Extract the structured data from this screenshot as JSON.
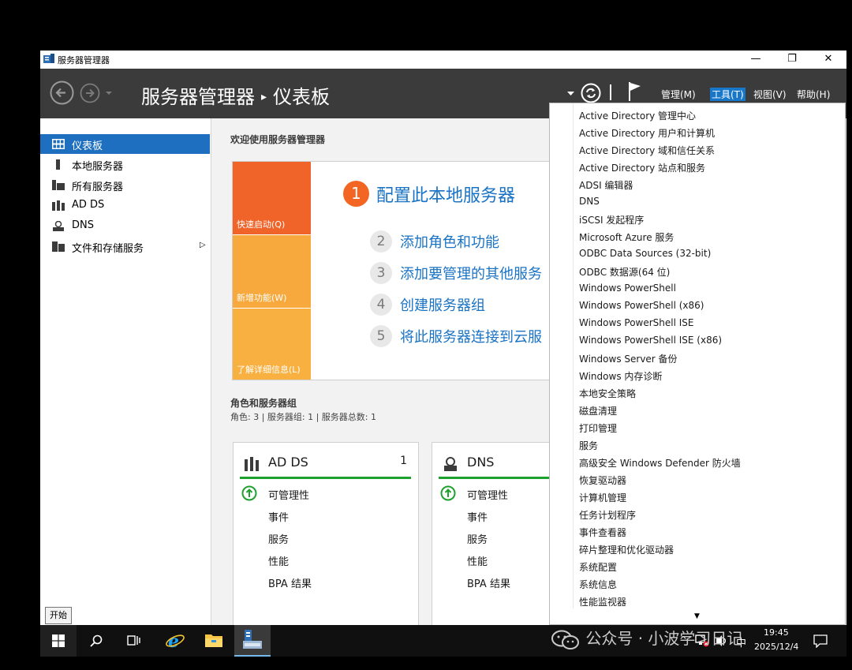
{
  "window": {
    "title": "服务器管理器",
    "buttons": {
      "minimize": "—",
      "maximize": "❐",
      "close": "✕"
    }
  },
  "header": {
    "app_name": "服务器管理器",
    "separator": "▸",
    "page": "仪表板",
    "menus": [
      {
        "label": "管理(M)",
        "active": false
      },
      {
        "label": "工具(T)",
        "active": true
      },
      {
        "label": "视图(V)",
        "active": false
      },
      {
        "label": "帮助(H)",
        "active": false
      }
    ]
  },
  "sidebar": {
    "items": [
      {
        "label": "仪表板",
        "icon": "dashboard-icon",
        "active": true
      },
      {
        "label": "本地服务器",
        "icon": "local-server-icon",
        "active": false
      },
      {
        "label": "所有服务器",
        "icon": "all-servers-icon",
        "active": false
      },
      {
        "label": "AD DS",
        "icon": "ad-ds-icon",
        "active": false
      },
      {
        "label": "DNS",
        "icon": "dns-icon",
        "active": false
      },
      {
        "label": "文件和存储服务",
        "icon": "file-storage-icon",
        "active": false,
        "has_children": true
      }
    ]
  },
  "welcome": {
    "title": "欢迎使用服务器管理器",
    "tiles": [
      {
        "label": "快速启动(Q)",
        "color": "#f0642a"
      },
      {
        "label": "新增功能(W)",
        "color": "#f8a93d"
      },
      {
        "label": "了解详细信息(L)",
        "color": "#f8b040"
      }
    ],
    "steps": [
      {
        "num": "1",
        "label": "配置此本地服务器"
      },
      {
        "num": "2",
        "label": "添加角色和功能"
      },
      {
        "num": "3",
        "label": "添加要管理的其他服务"
      },
      {
        "num": "4",
        "label": "创建服务器组"
      },
      {
        "num": "5",
        "label": "将此服务器连接到云服"
      }
    ]
  },
  "roles": {
    "title": "角色和服务器组",
    "summary": "角色: 3 | 服务器组: 1 | 服务器总数: 1",
    "cards": [
      {
        "name": "AD DS",
        "count": "1",
        "icon": "ad-ds-icon",
        "rows": [
          "可管理性",
          "事件",
          "服务",
          "性能",
          "BPA 结果"
        ]
      },
      {
        "name": "DNS",
        "count": "",
        "icon": "dns-icon",
        "rows": [
          "可管理性",
          "事件",
          "服务",
          "性能",
          "BPA 结果"
        ]
      }
    ]
  },
  "tools_menu": {
    "items": [
      "Active Directory 管理中心",
      "Active Directory 用户和计算机",
      "Active Directory 域和信任关系",
      "Active Directory 站点和服务",
      "ADSI 编辑器",
      "DNS",
      "iSCSI 发起程序",
      "Microsoft Azure 服务",
      "ODBC Data Sources (32-bit)",
      "ODBC 数据源(64 位)",
      "Windows PowerShell",
      "Windows PowerShell (x86)",
      "Windows PowerShell ISE",
      "Windows PowerShell ISE (x86)",
      "Windows Server 备份",
      "Windows 内存诊断",
      "本地安全策略",
      "磁盘清理",
      "打印管理",
      "服务",
      "高级安全 Windows Defender 防火墙",
      "恢复驱动器",
      "计算机管理",
      "任务计划程序",
      "事件查看器",
      "碎片整理和优化驱动器",
      "系统配置",
      "系统信息",
      "性能监视器"
    ],
    "more_indicator": "▼"
  },
  "taskbar": {
    "start_tooltip": "开始",
    "clock_time": "19:45",
    "clock_date": "2025/12/4",
    "ime": "中"
  },
  "watermark": {
    "text": "公众号 · 小波学习日记"
  },
  "colors": {
    "accent": "#1e6fbf",
    "header_bg": "#3b3b3b",
    "green_line": "#1fa12f"
  }
}
